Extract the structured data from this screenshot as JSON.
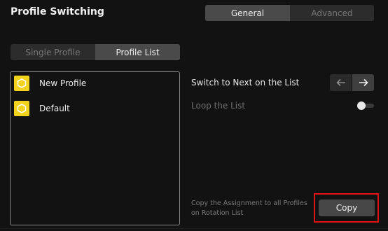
{
  "header": {
    "title": "Profile Switching",
    "tabs": [
      {
        "label": "General",
        "active": true
      },
      {
        "label": "Advanced",
        "active": false
      }
    ]
  },
  "mode": {
    "options": [
      {
        "label": "Single Profile",
        "active": false
      },
      {
        "label": "Profile List",
        "active": true
      }
    ]
  },
  "profiles": {
    "items": [
      {
        "label": "New Profile",
        "icon": "profile-icon"
      },
      {
        "label": "Default",
        "icon": "profile-icon"
      }
    ]
  },
  "settings": {
    "switch_next_label": "Switch to Next on the List",
    "loop_label": "Loop the List",
    "loop_enabled": false
  },
  "copy": {
    "help_text": "Copy the Assignment to all Profiles on Rotation List",
    "button_label": "Copy"
  },
  "colors": {
    "profile_icon_bg": "#f2d21b",
    "highlight": "#e01414",
    "active_segment": "#4a4a4a"
  }
}
